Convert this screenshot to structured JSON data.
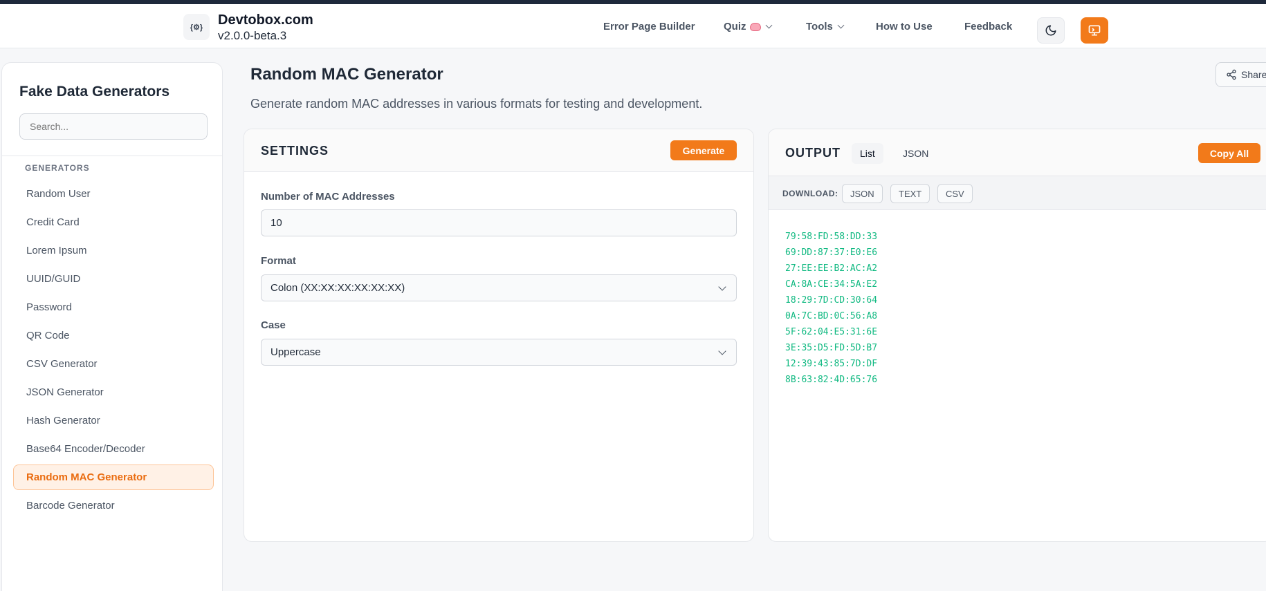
{
  "header": {
    "logo_text": "{⚙}",
    "brand_name": "Devtobox.com",
    "version": "v2.0.0-beta.3",
    "nav": [
      {
        "label": "Error Page Builder"
      },
      {
        "label": "Quiz",
        "icon": "brain-icon"
      },
      {
        "label": "Tools",
        "icon": "chevron-down-icon"
      },
      {
        "label": "How to Use"
      },
      {
        "label": "Feedback"
      }
    ],
    "theme_toggle_icon": "moon-icon",
    "screen_icon": "monitor-icon",
    "accent_color": "#f27a1a"
  },
  "sidebar": {
    "title": "Fake Data Generators",
    "search_placeholder": "Search...",
    "section_label": "GENERATORS",
    "items": [
      {
        "label": "Random User"
      },
      {
        "label": "Credit Card"
      },
      {
        "label": "Lorem Ipsum"
      },
      {
        "label": "UUID/GUID"
      },
      {
        "label": "Password"
      },
      {
        "label": "QR Code"
      },
      {
        "label": "CSV Generator"
      },
      {
        "label": "JSON Generator"
      },
      {
        "label": "Hash Generator"
      },
      {
        "label": "Base64 Encoder/Decoder"
      },
      {
        "label": "Random MAC Generator",
        "active": true
      },
      {
        "label": "Barcode Generator"
      }
    ]
  },
  "main": {
    "title": "Random MAC Generator",
    "subtitle": "Generate random MAC addresses in various formats for testing and development.",
    "share_label": "Share",
    "settings": {
      "title": "SETTINGS",
      "generate_label": "Generate",
      "count_label": "Number of MAC Addresses",
      "count_value": "10",
      "format_label": "Format",
      "format_value": "Colon (XX:XX:XX:XX:XX:XX)",
      "case_label": "Case",
      "case_value": "Uppercase"
    },
    "output": {
      "title": "OUTPUT",
      "tabs": [
        {
          "label": "List",
          "active": true
        },
        {
          "label": "JSON"
        }
      ],
      "copy_all_label": "Copy All",
      "download_label": "DOWNLOAD:",
      "download_buttons": [
        {
          "label": "JSON"
        },
        {
          "label": "TEXT"
        },
        {
          "label": "CSV"
        }
      ],
      "mac_color": "#10b981",
      "addresses": [
        "79:58:FD:58:DD:33",
        "69:DD:87:37:E0:E6",
        "27:EE:EE:B2:AC:A2",
        "CA:8A:CE:34:5A:E2",
        "18:29:7D:CD:30:64",
        "0A:7C:BD:0C:56:A8",
        "5F:62:04:E5:31:6E",
        "3E:35:D5:FD:5D:B7",
        "12:39:43:85:7D:DF",
        "8B:63:82:4D:65:76"
      ]
    }
  }
}
